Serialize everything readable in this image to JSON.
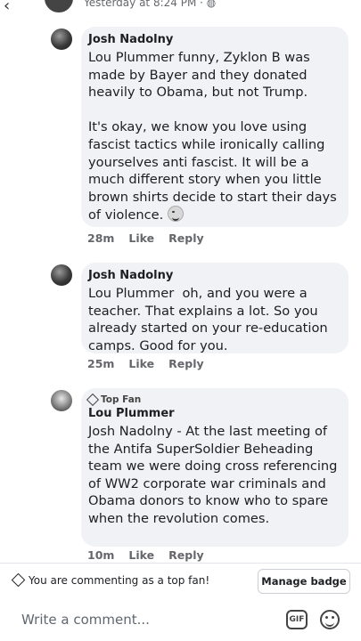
{
  "post_header": {
    "timestamp": "Yesterday at 8:24 PM · ",
    "privacy_icon": "globe-icon"
  },
  "comments": [
    {
      "author": "Josh Nadolny",
      "text": "Lou Plummer funny, Zyklon B was made by Bayer and they donated heavily to Obama, but not Trump.\n\nIt's okay, we know you love using fascist tactics while ironically calling yourselves anti fascist. It will be a much different story when you little brown shirts decide to start their days of violence. ",
      "emoji": "winking-face-icon",
      "time": "28m",
      "like": "Like",
      "reply": "Reply"
    },
    {
      "author": "Josh Nadolny",
      "text": "Lou Plummer  oh, and you were a teacher. That explains a lot. So you already started on your re-education camps. Good for you.",
      "time": "25m",
      "like": "Like",
      "reply": "Reply"
    },
    {
      "badge": "Top Fan",
      "author": "Lou Plummer",
      "text": "Josh Nadolny - At the last meeting of the Antifa SuperSoldier Beheading team we were doing cross referencing of WW2 corporate war criminals and Obama donors to know who to spare when the revolution comes.",
      "time": "10m",
      "like": "Like",
      "reply": "Reply"
    }
  ],
  "top_fan_bar": {
    "message": "You are commenting as a top fan!",
    "button": "Manage badge"
  },
  "composer": {
    "placeholder": "Write a comment...",
    "gif_label": "GIF"
  }
}
